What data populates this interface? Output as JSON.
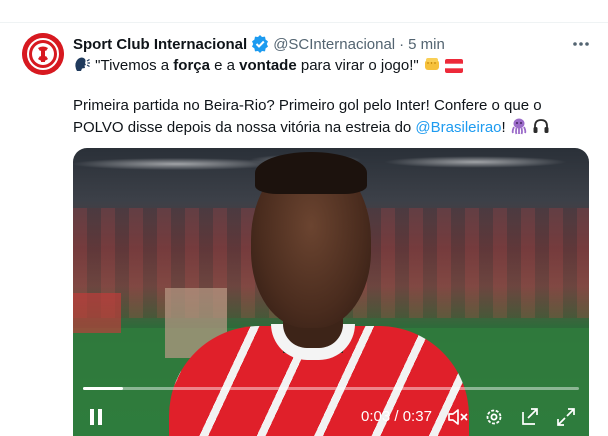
{
  "tweet": {
    "author_name": "Sport Club Internacional",
    "handle": "@SCInternacional",
    "separator": "·",
    "time": "5 min",
    "line1": {
      "prefix": "\"Tivemos a ",
      "bold1": "força",
      "middle": " e a ",
      "bold2": "vontade",
      "suffix": " para virar o jogo!\""
    },
    "line2": "Primeira partida no Beira-Rio? Primeiro gol pelo Inter! Confere o que o",
    "line3": {
      "prefix": "POLVO disse depois da nossa vitória na estreia do ",
      "mention": "@Brasileirao",
      "suffix": "!"
    }
  },
  "video": {
    "current_time": "0:03",
    "time_separator": " / ",
    "duration": "0:37",
    "progress_fraction": 0.081
  },
  "colors": {
    "brand_red": "#d71920",
    "verified_blue": "#1d9bf0",
    "link_blue": "#1d9bf0",
    "muted_text": "#536471"
  },
  "icons": [
    "speaking-head-icon",
    "fist-icon",
    "austria-flag-icon",
    "octopus-icon",
    "headphones-icon",
    "verified-badge-icon",
    "more-icon",
    "pause-icon",
    "mute-icon",
    "settings-icon",
    "pip-icon",
    "fullscreen-icon"
  ]
}
